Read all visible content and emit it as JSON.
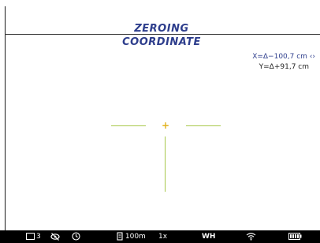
{
  "title": {
    "line1": "ZEROING",
    "line2": "COORDINATE"
  },
  "coordinates": {
    "x_text": "X=Δ−100,7 cm ‹›",
    "y_text": "Y=Δ+91,7 cm"
  },
  "reticle": {
    "line_color": "#a8c84a",
    "center_color": "#e2b31e",
    "center_glyph": "+"
  },
  "status_bar": {
    "profile_number": "3",
    "distance": "100m",
    "zoom": "1x",
    "palette": "WH",
    "icons": [
      "profile-icon",
      "hide-eye-icon",
      "timer-icon",
      "rangefinder-icon",
      "wifi-icon",
      "battery-icon"
    ]
  },
  "colors": {
    "title": "#2d3d8c",
    "background": "#ffffff",
    "status_bar": "#000000"
  }
}
